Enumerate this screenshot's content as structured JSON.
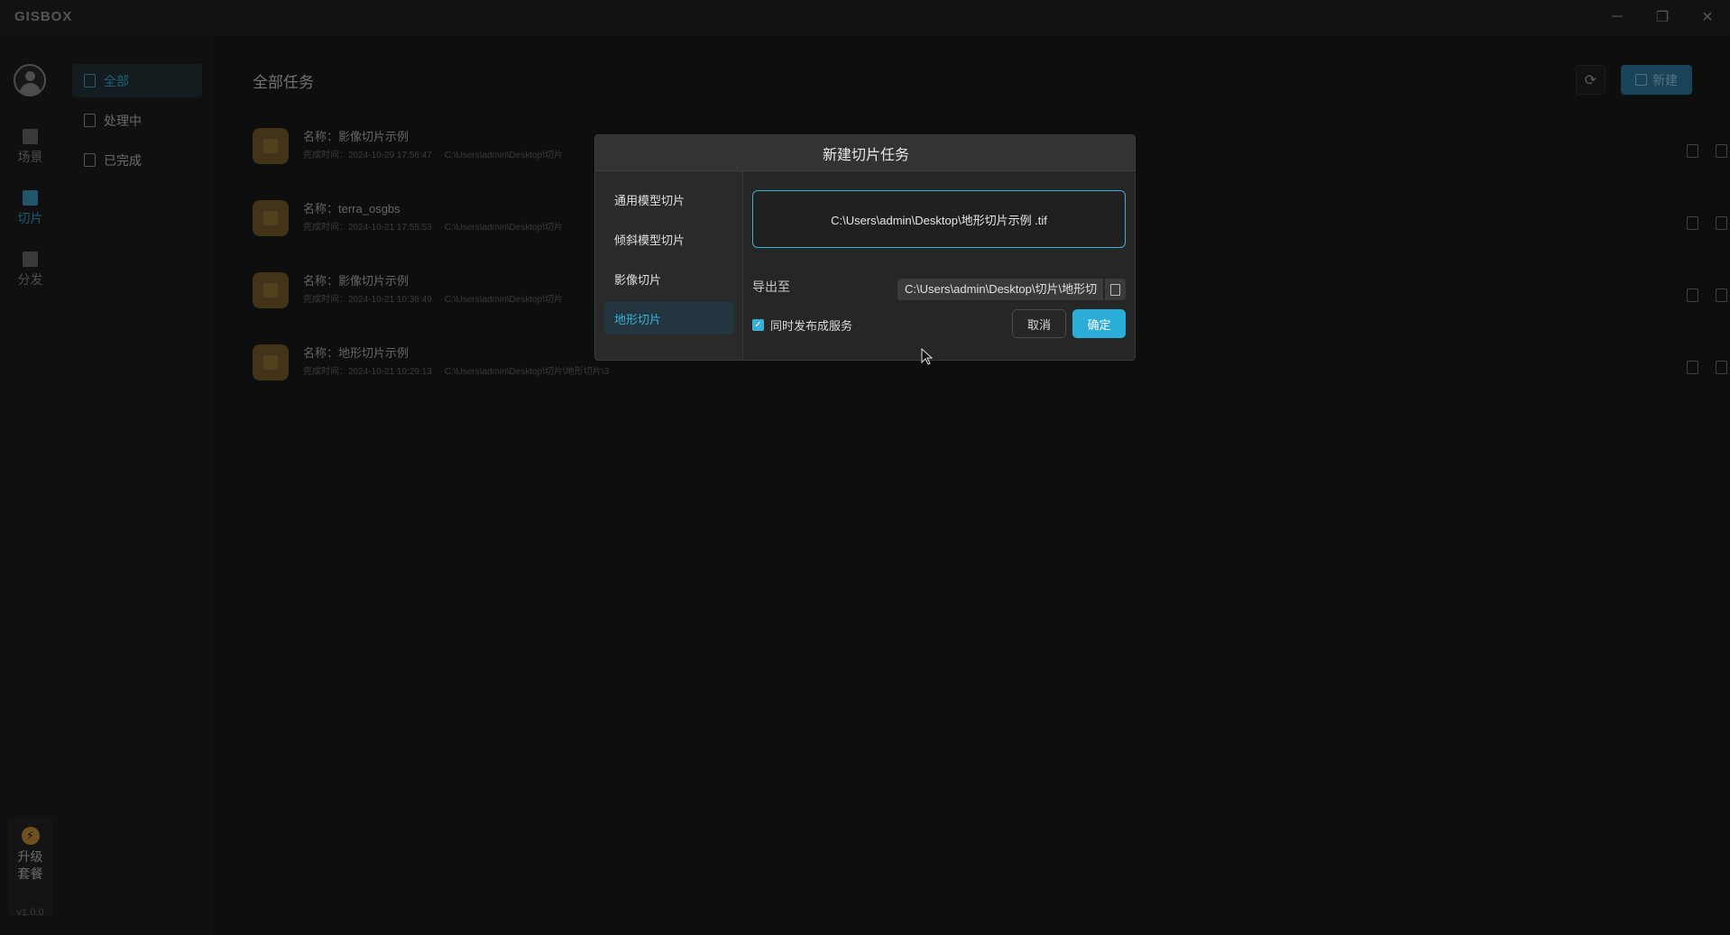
{
  "app": {
    "logo": "GISBOX",
    "version": "v1.0.0",
    "window_controls": {
      "minimize": "─",
      "restore": "❐",
      "close": "✕"
    }
  },
  "rail": {
    "items": [
      {
        "label": "场景",
        "icon": "scene-icon"
      },
      {
        "label": "切片",
        "icon": "slice-icon"
      },
      {
        "label": "分发",
        "icon": "distribute-icon"
      }
    ],
    "upgrade_line1": "升级",
    "upgrade_line2": "套餐",
    "upgrade_icon": "⚡"
  },
  "subnav": {
    "items": [
      {
        "label": "全部"
      },
      {
        "label": "处理中"
      },
      {
        "label": "已完成"
      }
    ]
  },
  "main": {
    "title": "全部任务",
    "new_label": "新建",
    "refresh_icon": "⟳"
  },
  "tasks": [
    {
      "name": "名称：影像切片示例",
      "time": "完成时间：2024-10-29 17:56:47",
      "path": "C:\\Users\\admin\\Desktop\\切片"
    },
    {
      "name": "名称：terra_osgbs",
      "time": "完成时间：2024-10-21 17:55:53",
      "path": "C:\\Users\\admin\\Desktop\\切片"
    },
    {
      "name": "名称：影像切片示例",
      "time": "完成时间：2024-10-21 10:36:49",
      "path": "C:\\Users\\admin\\Desktop\\切片"
    },
    {
      "name": "名称：地形切片示例",
      "time": "完成时间：2024-10-21 10:29:13",
      "path": "C:\\Users\\admin\\Desktop\\切片\\地形切片\\3"
    }
  ],
  "dialog": {
    "title": "新建切片任务",
    "nav": [
      {
        "label": "通用模型切片"
      },
      {
        "label": "倾斜模型切片"
      },
      {
        "label": "影像切片"
      },
      {
        "label": "地形切片"
      }
    ],
    "file_path": "C:\\Users\\admin\\Desktop\\地形切片示例 .tif",
    "export_label": "导出至",
    "export_value": "C:\\Users\\admin\\Desktop\\切片\\地形切",
    "publish_label": "同时发布成服务",
    "publish_checked": true,
    "cancel_label": "取消",
    "ok_label": "确定"
  },
  "colors": {
    "accent": "#3ab0d8",
    "primary_button": "#2aaed8",
    "thumb": "#7a5d2d"
  }
}
